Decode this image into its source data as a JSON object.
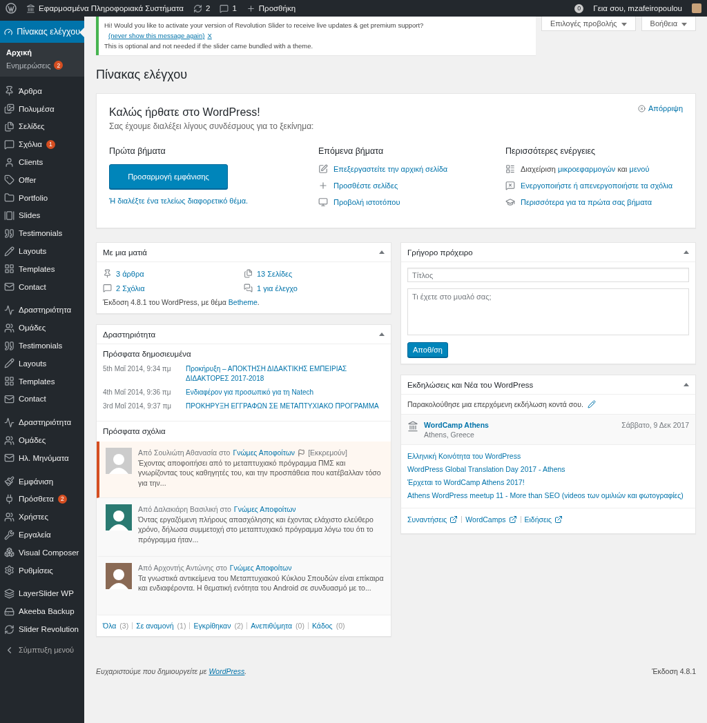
{
  "admin_bar": {
    "site_name": "Εφαρμοσμένα Πληροφοριακά Συστήματα",
    "updates": "2",
    "comments": "1",
    "new": "Προσθήκη",
    "notifications": "0",
    "greeting": "Γεια σου, mzafeiropoulou"
  },
  "sidebar": {
    "groups": [
      {
        "items": [
          {
            "label": "Πίνακας ελέγχου",
            "selected": true,
            "children": [
              {
                "label": "Αρχική",
                "selected": true
              },
              {
                "label": "Ενημερώσεις",
                "selected": false,
                "badge": "2"
              }
            ]
          }
        ]
      },
      {
        "items": [
          {
            "label": "Άρθρα",
            "selected": false
          },
          {
            "label": "Πολυμέσα",
            "selected": false
          },
          {
            "label": "Σελίδες",
            "selected": false
          },
          {
            "label": "Σχόλια",
            "selected": false,
            "badge": "1"
          },
          {
            "label": "Clients",
            "selected": false
          },
          {
            "label": "Offer",
            "selected": false
          },
          {
            "label": "Portfolio",
            "selected": false
          },
          {
            "label": "Slides",
            "selected": false
          },
          {
            "label": "Testimonials",
            "selected": false
          },
          {
            "label": "Layouts",
            "selected": false
          },
          {
            "label": "Templates",
            "selected": false
          },
          {
            "label": "Contact",
            "selected": false
          }
        ]
      },
      {
        "items": [
          {
            "label": "Δραστηριότητα",
            "selected": false
          },
          {
            "label": "Ομάδες",
            "selected": false
          },
          {
            "label": "Testimonials",
            "selected": false
          },
          {
            "label": "Layouts",
            "selected": false
          },
          {
            "label": "Templates",
            "selected": false
          },
          {
            "label": "Contact",
            "selected": false
          }
        ]
      },
      {
        "items": [
          {
            "label": "Δραστηριότητα",
            "selected": false
          },
          {
            "label": "Ομάδες",
            "selected": false
          },
          {
            "label": "Ηλ. Μηνύματα",
            "selected": false
          }
        ]
      },
      {
        "items": [
          {
            "label": "Εμφάνιση",
            "selected": false
          },
          {
            "label": "Πρόσθετα",
            "selected": false,
            "badge": "2"
          },
          {
            "label": "Χρήστες",
            "selected": false
          },
          {
            "label": "Εργαλεία",
            "selected": false
          },
          {
            "label": "Visual Composer",
            "selected": false
          },
          {
            "label": "Ρυθμίσεις",
            "selected": false
          }
        ]
      },
      {
        "items": [
          {
            "label": "LayerSlider WP",
            "selected": false
          },
          {
            "label": "Akeeba Backup",
            "selected": false
          },
          {
            "label": "Slider Revolution",
            "selected": false
          }
        ]
      }
    ],
    "collapse": "Σύμπτυξη μενού"
  },
  "notice": {
    "text": "Hi! Would you like to activate your version of Revolution Slider to receive live updates & get premium support?",
    "link": "(never show this message again)",
    "close": "X",
    "note": "This is optional and not needed if the slider came bundled with a theme."
  },
  "screen_tabs": [
    "Επιλογές προβολής",
    "Βοήθεια"
  ],
  "page_title": "Πίνακας ελέγχου",
  "welcome": {
    "title": "Καλώς ήρθατε στο WordPress!",
    "subtitle": "Σας έχουμε διαλέξει λίγους συνδέσμους για το ξεκίνημα:",
    "dismiss": "Απόρριψη",
    "first_steps": {
      "heading": "Πρώτα βήματα",
      "button": "Προσαρμογή εμφάνισης",
      "link": "Ή διαλέξτε ένα τελείως διαφορετικό θέμα."
    },
    "next_steps": {
      "heading": "Επόμενα βήματα",
      "links": [
        "Επεξεργαστείτε την αρχική σελίδα",
        "Προσθέστε σελίδες",
        "Προβολή ιστοτόπου"
      ]
    },
    "more_actions": {
      "heading": "Περισσότερες ενέργειες",
      "items": [
        {
          "parts": [
            {
              "text": "Διαχείριση",
              "link": false
            },
            {
              "text": "μικροεφαρμογών",
              "link": true
            },
            {
              "text": "και",
              "link": false
            },
            {
              "text": "μενού",
              "link": true
            }
          ]
        },
        {
          "parts": [
            {
              "text": "Ενεργοποιήστε ή απενεργοποιήστε τα σχόλια",
              "link": true
            }
          ]
        },
        {
          "parts": [
            {
              "text": "Περισσότερα για τα πρώτα σας βήματα",
              "link": true
            }
          ]
        }
      ]
    }
  },
  "at_a_glance": {
    "title": "Με μια ματιά",
    "stats": [
      "3 άρθρα",
      "13 Σελίδες",
      "2 Σχόλια",
      "1 για έλεγχο"
    ],
    "version_text": "Έκδοση 4.8.1 του WordPress, με θέμα",
    "theme": "Betheme",
    "version_end": "."
  },
  "activity": {
    "title": "Δραστηριότητα",
    "published_heading": "Πρόσφατα δημοσιευμένα",
    "published": [
      {
        "date": "5th Μαΐ 2014, 9:34 πμ",
        "title": "Προκήρυξη – ΑΠΟΚΤΗΣΗ ΔΙΔΑΚΤΙΚΗΣ ΕΜΠΕΙΡΙΑΣ ΔΙΔΑΚΤΟΡΕΣ 2017-2018"
      },
      {
        "date": "4th Μαΐ 2014, 9:36 πμ",
        "title": "Ενδιαφέρον για προσωπικό για τη Natech"
      },
      {
        "date": "3rd Μαΐ 2014, 9:37 πμ",
        "title": "ΠΡΟΚΗΡΥΞΗ ΕΓΓΡΑΦΩΝ ΣΕ ΜΕΤΑΠΤΥΧΙΑΚΟ ΠΡΟΓΡΑΜΜΑ"
      }
    ],
    "comments_heading": "Πρόσφατα σχόλια",
    "comments": [
      {
        "author": "Από Σουλιώτη Αθανασία στο",
        "post": "Γνώμες Αποφοίτων",
        "pending": true,
        "status": "[Εκκρεμούν]",
        "excerpt": "Έχοντας αποφοιτήσει από το μεταπτυχιακό πρόγραμμα ΠΜΣ και γνωρίζοντας τους καθηγητές του, και την προσπάθεια που κατέβαλλαν τόσο για την..."
      },
      {
        "author": "Από Δαλακιάρη Βασιλική στο",
        "post": "Γνώμες Αποφοίτων",
        "pending": false,
        "excerpt": "Όντας εργαζόμενη πλήρους απασχόλησης και έχοντας ελάχιστο ελεύθερο χρόνο, δήλωσα συμμετοχή στο μεταπτυχιακό πρόγραμμα λόγω του ότι το πρόγραμμα ήταν..."
      },
      {
        "author": "Από Αρχοντής Αντώνης στο",
        "post": "Γνώμες Αποφοίτων",
        "pending": false,
        "excerpt": "Τα γνωστικά αντικείμενα του Μεταπτυχιακού Κύκλου Σπουδών είναι επίκαιρα και ενδιαφέροντα. Η θεματική ενότητα του Android σε συνδυασμό με το..."
      }
    ],
    "filters": [
      {
        "label": "Όλα",
        "count": "(3)"
      },
      {
        "label": "Σε αναμονή",
        "count": "(1)"
      },
      {
        "label": "Εγκρίθηκαν",
        "count": "(2)"
      },
      {
        "label": "Ανεπιθύμητα",
        "count": "(0)"
      },
      {
        "label": "Κάδος",
        "count": "(0)"
      }
    ]
  },
  "quick_draft": {
    "title": "Γρήγορο πρόχειρο",
    "title_placeholder": "Τίτλος",
    "content_placeholder": "Τι έχετε στο μυαλό σας;",
    "button": "Αποθ/ση"
  },
  "events": {
    "title": "Εκδηλώσεις και Νέα του WordPress",
    "intro": "Παρακολούθησε μια επερχόμενη εκδήλωση κοντά σου.",
    "event": {
      "name": "WordCamp Athens",
      "location": "Athens, Greece",
      "date": "Σάββατο, 9 Δεκ 2017"
    },
    "news": [
      "Ελληνική Κοινότητα του WordPress",
      "WordPress Global Translation Day 2017 - Athens",
      "Έρχεται το WordCamp Athens 2017!",
      "Athens WordPress meetup 11 - More than SEO (videos των ομιλιών και φωτογραφίες)"
    ],
    "footer_links": [
      "Συναντήσεις",
      "WordCamps",
      "Ειδήσεις"
    ]
  },
  "footer": {
    "thanks": "Ευχαριστούμε που δημιουργείτε με",
    "link": "WordPress",
    "end": ".",
    "version": "Έκδοση 4.8.1"
  }
}
